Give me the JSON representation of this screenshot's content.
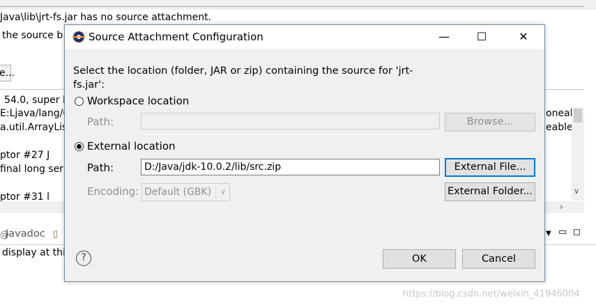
{
  "background": {
    "line1": "Java\\lib\\jrt-fs.jar has no source attachment.",
    "line2": "the source b",
    "button_fragment": "e...",
    "lines": [
      "54.0, super l",
      "E:Ljava/lang/C",
      "a.util.ArrayLis",
      "ptor #27 J",
      "final long ser",
      "ptor #31 l"
    ],
    "right_fragments": [
      "oneal",
      "eable"
    ],
    "tab_label": "Javadoc",
    "bottom_text": "display at thi",
    "watermark": "https://blog.csdn.net/weixin_41946004"
  },
  "dialog": {
    "title": "Source Attachment Configuration",
    "window_buttons": {
      "minimize": "—",
      "maximize": "☐",
      "close": "✕"
    },
    "description": "Select the location (folder, JAR or zip) containing the source for 'jrt-fs.jar':",
    "workspace": {
      "label": "Workspace location",
      "selected": false,
      "path_label": "Path:",
      "path_value": "",
      "browse_label": "Browse..."
    },
    "external": {
      "label": "External location",
      "selected": true,
      "path_label": "Path:",
      "path_value": "D:/Java/jdk-10.0.2/lib/src.zip",
      "external_file_label": "External File...",
      "encoding_label": "Encoding:",
      "encoding_value": "Default (GBK)",
      "external_folder_label": "External Folder..."
    },
    "ok_label": "OK",
    "cancel_label": "Cancel",
    "help_icon": "?"
  }
}
